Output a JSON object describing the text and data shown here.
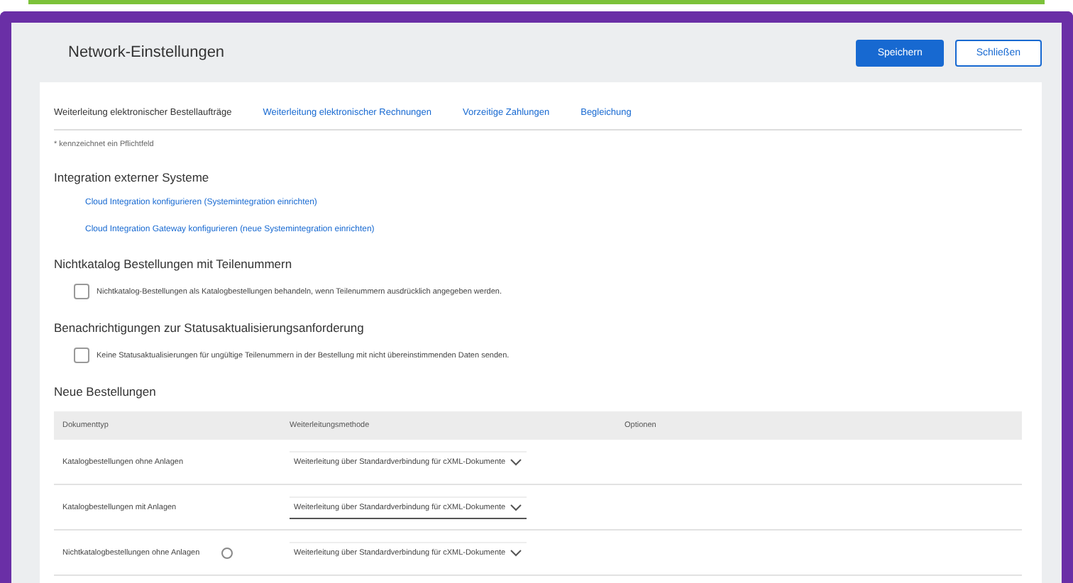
{
  "window": {
    "title": "Network-Einstellungen"
  },
  "buttons": [
    {
      "label": "Speichern",
      "kind": "primary"
    },
    {
      "label": "Schließen",
      "kind": "secondary"
    }
  ],
  "tabs": [
    {
      "label": "Weiterleitung elektronischer Bestellaufträge",
      "selected": true
    },
    {
      "label": "Weiterleitung elektronischer Rechnungen",
      "selected": false
    },
    {
      "label": "Vorzeitige Zahlungen",
      "selected": false
    },
    {
      "label": "Begleichung",
      "selected": false
    }
  ],
  "required_note": "* kennzeichnet ein Pflichtfeld",
  "integration": {
    "title": "Integration externer Systeme",
    "links": [
      "Cloud Integration konfigurieren (Systemintegration einrichten)",
      "Cloud Integration Gateway konfigurieren (neue Systemintegration einrichten)"
    ]
  },
  "options": [
    {
      "title": "Nichtkatalog Bestellungen mit Teilenummern",
      "label": "Nichtkatalog-Bestellungen als Katalogbestellungen behandeln, wenn Teilenummern ausdrücklich angegeben werden.",
      "checked": false
    },
    {
      "title": "Benachrichtigungen zur Statusaktualisierungsanforderung",
      "label": "Keine Statusaktualisierungen für ungültige Teilenummern in der Bestellung mit nicht übereinstimmenden Daten senden.",
      "checked": false
    }
  ],
  "new_orders": {
    "title": "Neue Bestellungen",
    "columns": [
      "Dokumenttyp",
      "Weiterleitungsmethode",
      "Optionen"
    ],
    "rows": [
      {
        "document": "Katalogbestellungen ohne Anlagen",
        "method": "Weiterleitung über Standardverbindung für cXML-Dokumente",
        "info": false,
        "focused": false
      },
      {
        "document": "Katalogbestellungen mit Anlagen",
        "method": "Weiterleitung über Standardverbindung für cXML-Dokumente",
        "info": false,
        "focused": true
      },
      {
        "document": "Nichtkatalogbestellungen ohne Anlagen",
        "method": "Weiterleitung über Standardverbindung für cXML-Dokumente",
        "info": true,
        "focused": false
      }
    ]
  }
}
